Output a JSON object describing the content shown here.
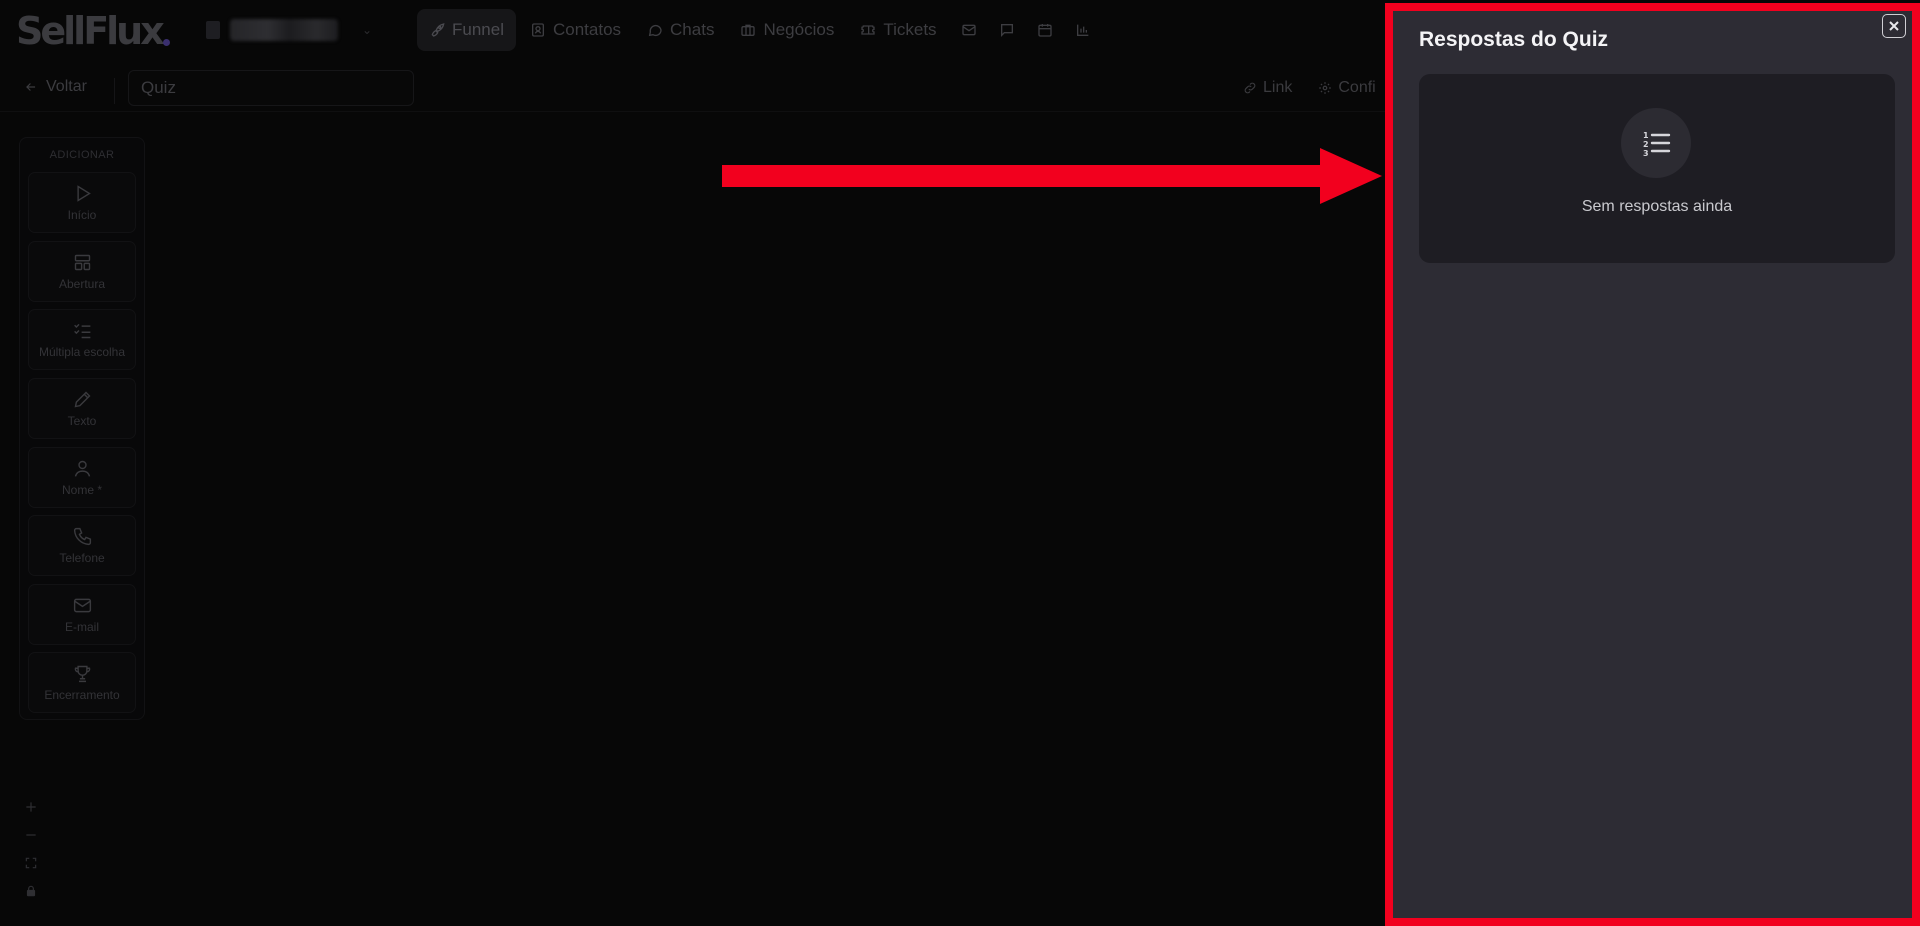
{
  "brand": {
    "logo_text": "SellFlux"
  },
  "nav": {
    "items": [
      {
        "label": "Funnel",
        "icon": "rocket-icon",
        "active": true
      },
      {
        "label": "Contatos",
        "icon": "contacts-icon"
      },
      {
        "label": "Chats",
        "icon": "chat-bubble-icon"
      },
      {
        "label": "Negócios",
        "icon": "briefcase-icon"
      },
      {
        "label": "Tickets",
        "icon": "ticket-icon"
      }
    ],
    "icon_items": [
      "mail-icon",
      "message-square-icon",
      "calendar-icon",
      "bar-chart-icon"
    ]
  },
  "toolbar": {
    "back_label": "Voltar",
    "quiz_name_value": "Quiz",
    "link_label": "Link",
    "config_label": "Confi"
  },
  "palette": {
    "title": "ADICIONAR",
    "items": [
      {
        "label": "Início",
        "icon": "play-icon"
      },
      {
        "label": "Abertura",
        "icon": "layout-icon"
      },
      {
        "label": "Múltipla escolha",
        "icon": "checklist-icon"
      },
      {
        "label": "Texto",
        "icon": "pencil-icon"
      },
      {
        "label": "Nome *",
        "icon": "user-icon"
      },
      {
        "label": "Telefone",
        "icon": "phone-icon"
      },
      {
        "label": "E-mail",
        "icon": "mail-icon"
      },
      {
        "label": "Encerramento",
        "icon": "trophy-icon"
      }
    ]
  },
  "zoom_controls": [
    "zoom-in-icon",
    "zoom-out-icon",
    "fit-view-icon",
    "lock-icon"
  ],
  "panel": {
    "title": "Respostas do Quiz",
    "empty_message": "Sem respostas ainda",
    "empty_icon": "numbered-list-icon"
  },
  "colors": {
    "highlight": "#f2001e",
    "panel_bg": "#2d2c34",
    "card_bg": "#1e1d23",
    "page_bg": "#070707"
  }
}
